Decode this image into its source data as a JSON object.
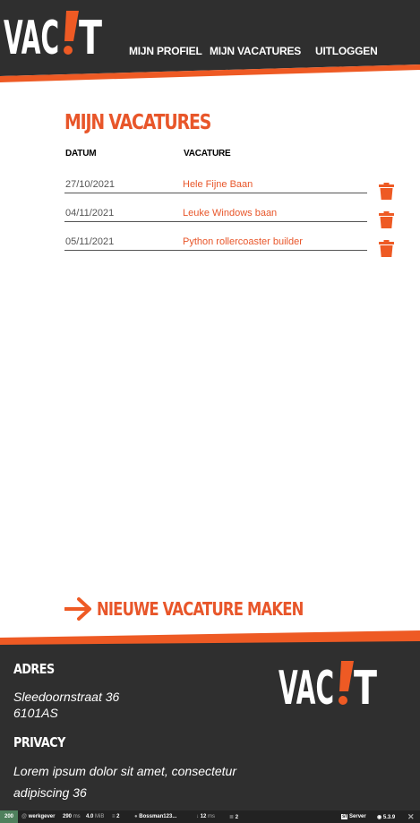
{
  "header": {
    "nav": [
      {
        "label": "MIJN PROFIEL"
      },
      {
        "label": "MIJN VACATURES"
      },
      {
        "label": "UITLOGGEN"
      }
    ]
  },
  "main": {
    "title": "MIJN VACATURES",
    "columns": {
      "date": "DATUM",
      "vacancy": "VACATURE"
    },
    "rows": [
      {
        "date": "27/10/2021",
        "title": "Hele Fijne Baan"
      },
      {
        "date": "04/11/2021",
        "title": "Leuke Windows baan"
      },
      {
        "date": "05/11/2021",
        "title": "Python rollercoaster builder"
      }
    ],
    "new_label": "NIEUWE VACATURE MAKEN"
  },
  "footer": {
    "address_heading": "ADRES",
    "address_line1": "Sleedoornstraat 36",
    "address_line2": "6101AS",
    "privacy_heading": "PRIVACY",
    "privacy_line1": "Lorem ipsum dolor sit amet, consectetur",
    "privacy_line2": "adipiscing 36"
  },
  "debug": {
    "status": "200",
    "user_role": "werkgever",
    "time": "290",
    "time_unit": "ms",
    "memory": "4.0",
    "memory_unit": "MiB",
    "layers": "2",
    "user": "Bossman123...",
    "requests_time": "12",
    "requests_unit": "ms",
    "db": "2",
    "server": "Server",
    "version": "5.3.9"
  },
  "colors": {
    "accent": "#e8562a",
    "dark": "#2f2f2f"
  }
}
